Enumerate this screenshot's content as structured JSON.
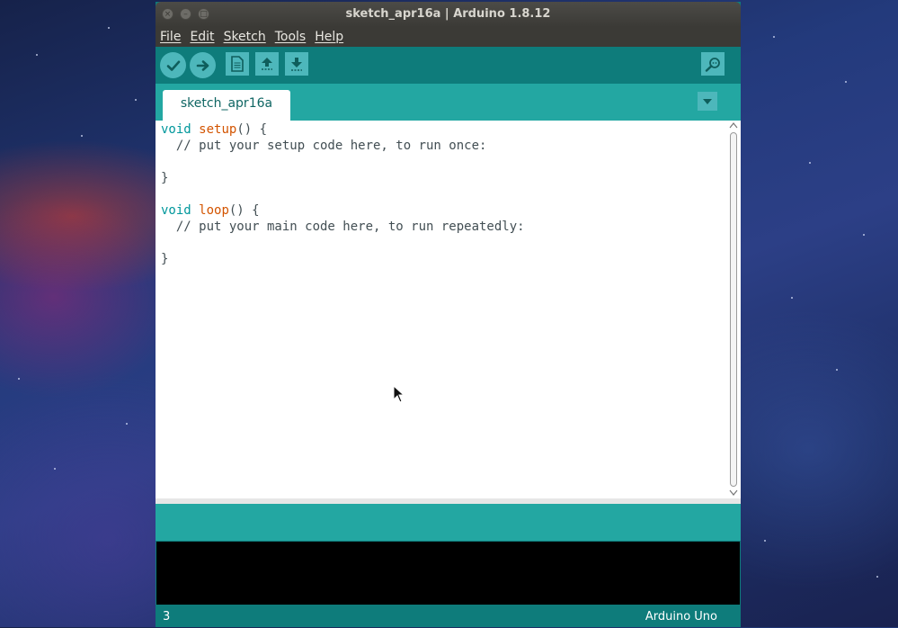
{
  "window": {
    "title": "sketch_apr16a | Arduino 1.8.12",
    "controls": [
      "close",
      "minimize",
      "maximize"
    ]
  },
  "menubar": {
    "items": [
      {
        "label": "File"
      },
      {
        "label": "Edit"
      },
      {
        "label": "Sketch"
      },
      {
        "label": "Tools"
      },
      {
        "label": "Help"
      }
    ]
  },
  "toolbar": {
    "buttons": [
      "verify-icon",
      "upload-icon",
      "new-icon",
      "open-icon",
      "save-icon"
    ],
    "right_button": "serial-monitor-icon"
  },
  "tabs": {
    "active": "sketch_apr16a",
    "menu_icon": "tab-dropdown-icon"
  },
  "editor": {
    "lines": [
      {
        "kw": "void",
        "fn": "setup",
        "rest": "() {"
      },
      {
        "comment": "  // put your setup code here, to run once:"
      },
      {
        "plain": ""
      },
      {
        "plain": "}"
      },
      {
        "plain": ""
      },
      {
        "kw": "void",
        "fn": "loop",
        "rest": "() {"
      },
      {
        "comment": "  // put your main code here, to run repeatedly:"
      },
      {
        "plain": ""
      },
      {
        "plain": "}"
      }
    ]
  },
  "status": {
    "line": "3",
    "board": "Arduino Uno"
  },
  "colors": {
    "toolbar_bg": "#0e7c7b",
    "tab_strip": "#23a7a2",
    "button_bg": "#4db7bb",
    "keyword": "#00979c",
    "function": "#d35400",
    "titlebar": "#3b3a36",
    "console_bg": "#000000"
  }
}
